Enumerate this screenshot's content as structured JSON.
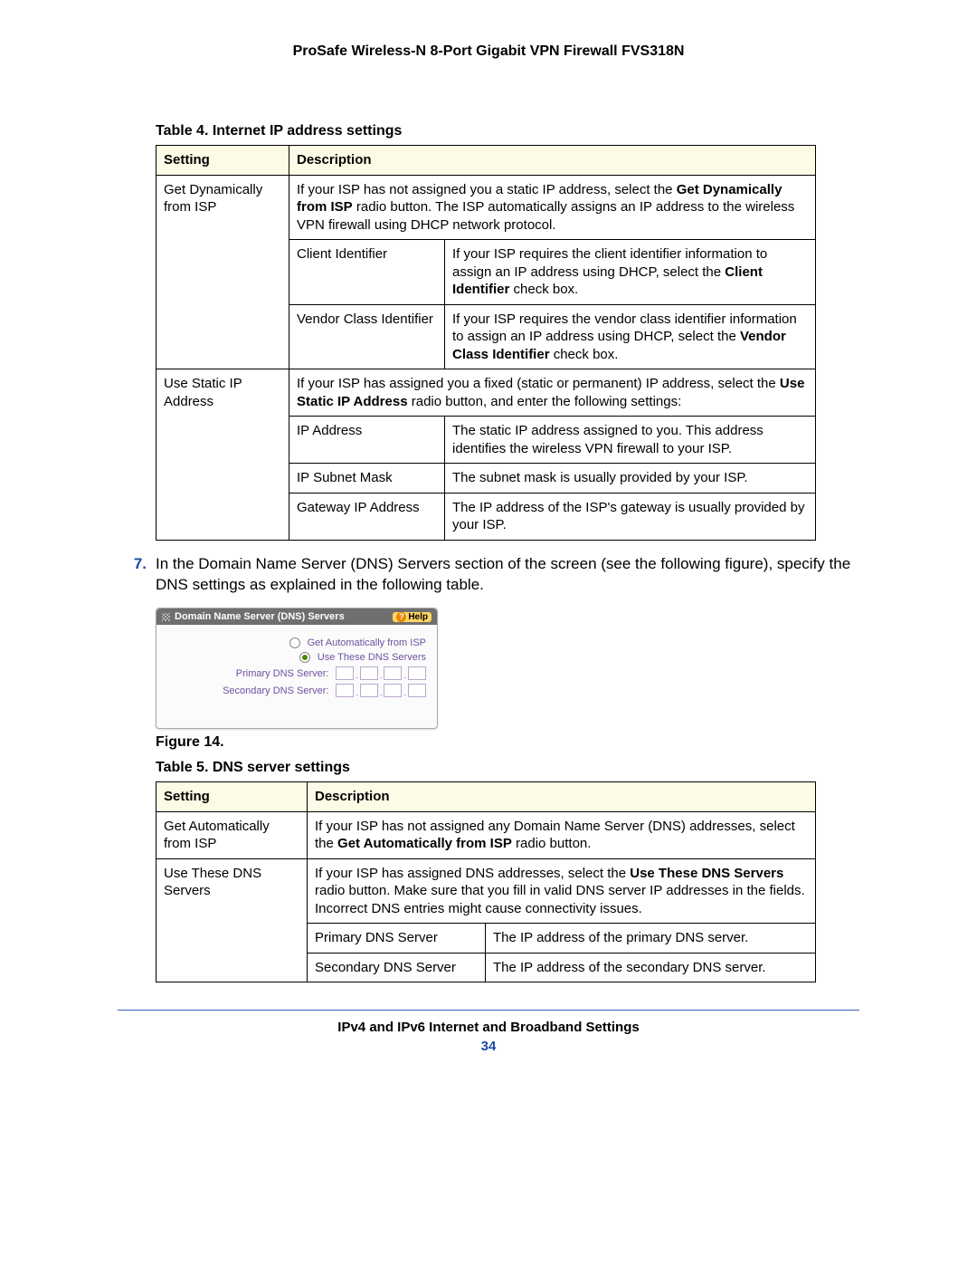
{
  "doc_title": "ProSafe Wireless-N 8-Port Gigabit VPN Firewall FVS318N",
  "table4": {
    "caption": "Table 4.  Internet IP address settings",
    "headers": {
      "setting": "Setting",
      "description": "Description"
    },
    "rows": {
      "dyn_label": "Get Dynamically from ISP",
      "dyn_desc_pre": "If your ISP has not assigned you a static IP address, select the ",
      "dyn_desc_bold": "Get Dynamically from ISP",
      "dyn_desc_post": " radio button. The ISP automatically assigns an IP address to the wireless VPN firewall using DHCP network protocol.",
      "client_id_label": "Client Identifier",
      "client_id_desc_pre": "If your ISP requires the client identifier information to assign an IP address using DHCP, select the ",
      "client_id_desc_bold": "Client Identifier",
      "client_id_desc_post": " check box.",
      "vendor_label": "Vendor Class Identifier",
      "vendor_desc_pre": "If your ISP requires the vendor class identifier information to assign an IP address using DHCP, select the ",
      "vendor_desc_bold": "Vendor Class Identifier",
      "vendor_desc_post": " check box.",
      "static_label": "Use Static IP Address",
      "static_desc_pre": "If your ISP has assigned you a fixed (static or permanent) IP address, select the ",
      "static_desc_bold": "Use Static IP Address",
      "static_desc_post": " radio button, and enter the following settings:",
      "ip_addr_label": "IP Address",
      "ip_addr_desc": "The static IP address assigned to you. This address identifies the wireless VPN firewall to your ISP.",
      "subnet_label": "IP Subnet Mask",
      "subnet_desc": "The subnet mask is usually provided by your ISP.",
      "gateway_label": "Gateway IP Address",
      "gateway_desc": "The IP address of the ISP's gateway is usually provided by your ISP."
    }
  },
  "step7": {
    "num": "7.",
    "text": "In the Domain Name Server (DNS) Servers section of the screen (see the following figure), specify the DNS settings as explained in the following table."
  },
  "dns_panel": {
    "title": "Domain Name Server (DNS) Servers",
    "help": "Help",
    "opt_auto": "Get Automatically from ISP",
    "opt_these": "Use These DNS Servers",
    "primary_label": "Primary DNS Server:",
    "secondary_label": "Secondary DNS Server:"
  },
  "figure14": "Figure 14.",
  "table5": {
    "caption": "Table 5.  DNS server settings",
    "headers": {
      "setting": "Setting",
      "description": "Description"
    },
    "rows": {
      "auto_label": "Get Automatically from ISP",
      "auto_desc_pre": "If your ISP has not assigned any Domain Name Server (DNS) addresses, select the ",
      "auto_desc_bold": "Get Automatically from ISP",
      "auto_desc_post": " radio button.",
      "use_label": "Use These DNS Servers",
      "use_desc_pre": "If your ISP has assigned DNS addresses, select the ",
      "use_desc_bold": "Use These DNS Servers",
      "use_desc_post": " radio button. Make sure that you fill in valid DNS server IP addresses in the fields. Incorrect DNS entries might cause connectivity issues.",
      "primary_label": "Primary DNS Server",
      "primary_desc": "The IP address of the primary DNS server.",
      "secondary_label": "Secondary DNS Server",
      "secondary_desc": "The IP address of the secondary DNS server."
    }
  },
  "footer": {
    "section": "IPv4 and IPv6 Internet and Broadband Settings",
    "page": "34"
  }
}
